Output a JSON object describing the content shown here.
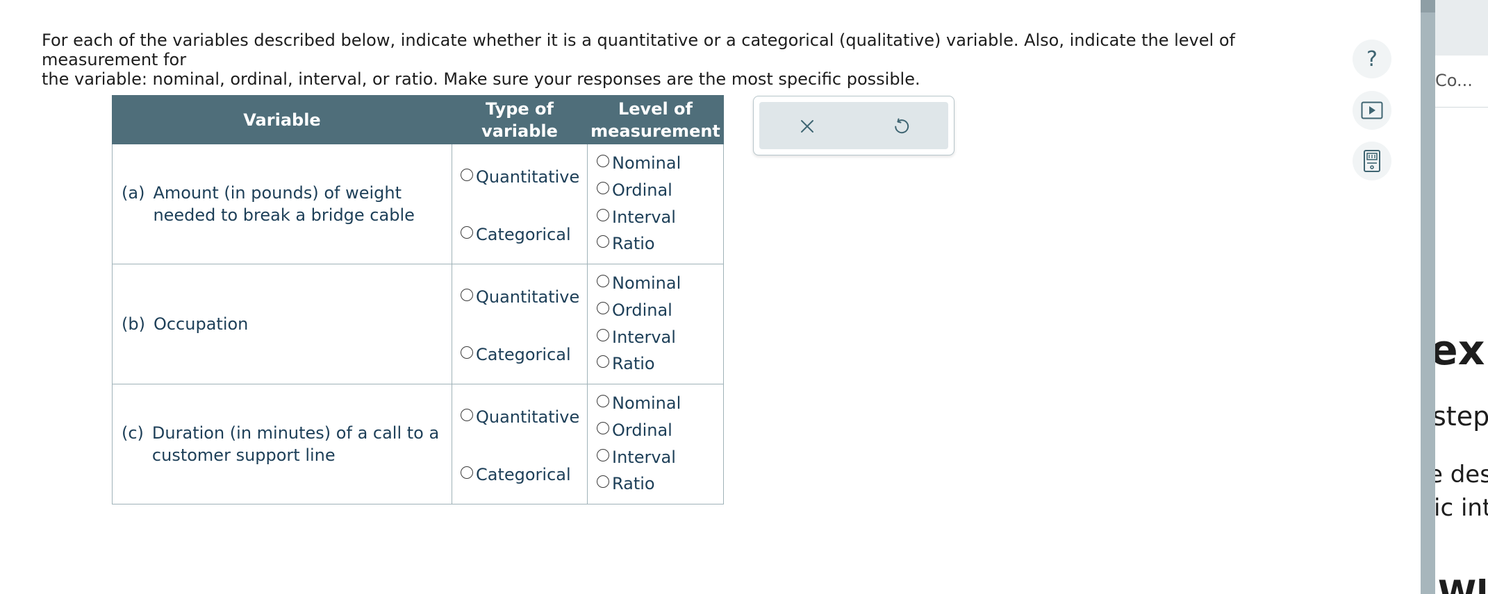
{
  "prompt": {
    "line1": "For each of the variables described below, indicate whether it is a quantitative or a categorical (qualitative) variable. Also, indicate the level of measurement for",
    "line2": "the variable: nominal, ordinal, interval, or ratio. Make sure your responses are the most specific possible."
  },
  "table": {
    "headers": {
      "variable": "Variable",
      "type_line1": "Type of",
      "type_line2": "variable",
      "level_line1": "Level of",
      "level_line2": "measurement"
    },
    "rows": [
      {
        "letter": "(a)",
        "text": "Amount (in pounds) of weight needed to break a bridge cable",
        "types": [
          "Quantitative",
          "Categorical"
        ],
        "levels": [
          "Nominal",
          "Ordinal",
          "Interval",
          "Ratio"
        ]
      },
      {
        "letter": "(b)",
        "text": "Occupation",
        "types": [
          "Quantitative",
          "Categorical"
        ],
        "levels": [
          "Nominal",
          "Ordinal",
          "Interval",
          "Ratio"
        ]
      },
      {
        "letter": "(c)",
        "text": "Duration (in minutes) of a call to a customer support line",
        "types": [
          "Quantitative",
          "Categorical"
        ],
        "levels": [
          "Nominal",
          "Ordinal",
          "Interval",
          "Ratio"
        ]
      }
    ]
  },
  "toolbox": {
    "clear_icon": "close-icon",
    "undo_icon": "undo-icon"
  },
  "side_buttons": {
    "help_label": "?",
    "video_icon": "video-play-icon",
    "calculator_icon": "calculator-icon"
  },
  "right_panel": {
    "title": "Co...",
    "heading": "exp",
    "line1": "step",
    "line2": "e desi",
    "line3": "ic inte",
    "line4": "Wl"
  },
  "colors": {
    "header_bg": "#4f6e7a",
    "toolbox_bg": "#dfe6e9",
    "side_icon": "#3f6572",
    "divider": "#a7b6bc",
    "text": "#1d3f58"
  }
}
